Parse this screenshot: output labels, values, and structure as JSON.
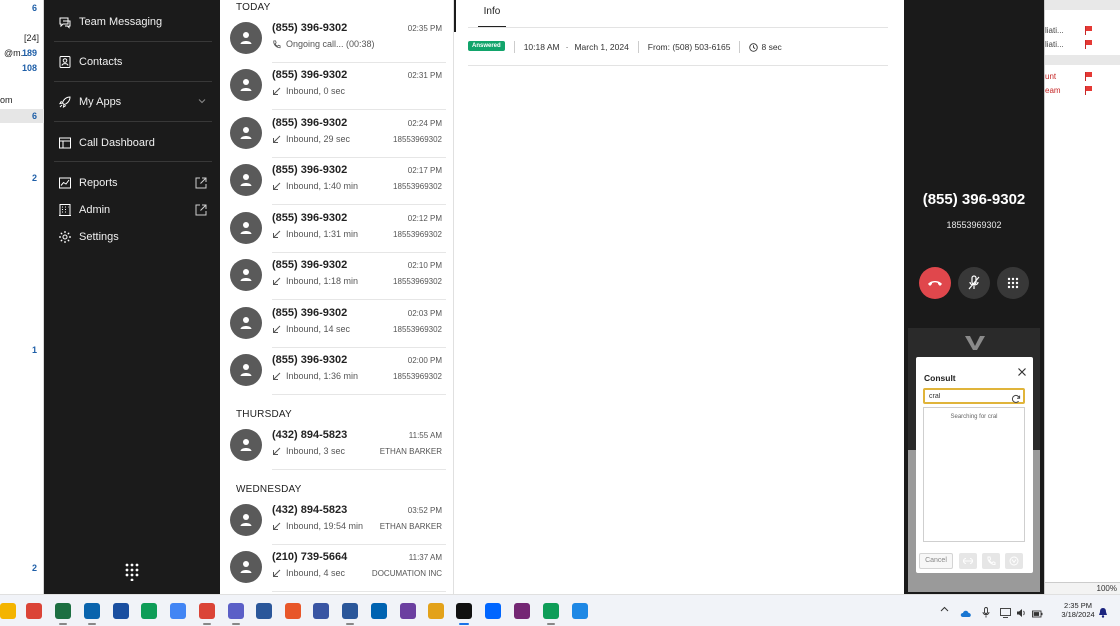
{
  "background_left": {
    "cells": [
      {
        "text": "6",
        "style": "blue"
      },
      {
        "text": "[24]",
        "style": "plain"
      },
      {
        "text": "@m...",
        "style": "plain"
      },
      {
        "text": "189",
        "style": "blue"
      },
      {
        "text": "108",
        "style": "blue"
      },
      {
        "text": "om",
        "style": "plain"
      },
      {
        "text": "6",
        "style": "blue"
      },
      {
        "text": "2",
        "style": "blue"
      },
      {
        "text": "1",
        "style": "blue"
      },
      {
        "text": "2",
        "style": "blue"
      }
    ]
  },
  "background_right": {
    "rows": [
      {
        "text": "liati...",
        "red": false
      },
      {
        "text": "liati...",
        "red": false
      },
      {
        "text": "unt",
        "red": true
      },
      {
        "text": "eam",
        "red": true
      }
    ],
    "zoom": "100%"
  },
  "sidebar": {
    "items": [
      {
        "label": "Team Messaging",
        "icon": "chat-bubbles-icon"
      },
      {
        "label": "Contacts",
        "icon": "contact-card-icon"
      },
      {
        "label": "My Apps",
        "icon": "rocket-icon"
      },
      {
        "label": "Call Dashboard",
        "icon": "dashboard-icon"
      },
      {
        "label": "Reports",
        "icon": "chart-icon"
      },
      {
        "label": "Admin",
        "icon": "building-icon"
      },
      {
        "label": "Settings",
        "icon": "gear-icon"
      }
    ]
  },
  "call_list": {
    "sections": [
      {
        "heading": "TODAY"
      },
      {
        "heading": "THURSDAY"
      },
      {
        "heading": "WEDNESDAY"
      }
    ],
    "calls": [
      {
        "number": "(855) 396-9302",
        "time": "02:35 PM",
        "detail": "Ongoing call... (00:38)",
        "ident": "",
        "kind": "ongoing"
      },
      {
        "number": "(855) 396-9302",
        "time": "02:31 PM",
        "detail": "Inbound, 0 sec",
        "ident": "",
        "kind": "inbound"
      },
      {
        "number": "(855) 396-9302",
        "time": "02:24 PM",
        "detail": "Inbound, 29 sec",
        "ident": "18553969302",
        "kind": "inbound"
      },
      {
        "number": "(855) 396-9302",
        "time": "02:17 PM",
        "detail": "Inbound, 1:40 min",
        "ident": "18553969302",
        "kind": "inbound"
      },
      {
        "number": "(855) 396-9302",
        "time": "02:12 PM",
        "detail": "Inbound, 1:31 min",
        "ident": "18553969302",
        "kind": "inbound"
      },
      {
        "number": "(855) 396-9302",
        "time": "02:10 PM",
        "detail": "Inbound, 1:18 min",
        "ident": "18553969302",
        "kind": "inbound"
      },
      {
        "number": "(855) 396-9302",
        "time": "02:03 PM",
        "detail": "Inbound, 14 sec",
        "ident": "18553969302",
        "kind": "inbound"
      },
      {
        "number": "(855) 396-9302",
        "time": "02:00 PM",
        "detail": "Inbound, 1:36 min",
        "ident": "18553969302",
        "kind": "inbound"
      },
      {
        "number": "(432) 894-5823",
        "time": "11:55 AM",
        "detail": "Inbound, 3 sec",
        "ident": "ETHAN BARKER",
        "kind": "inbound"
      },
      {
        "number": "(432) 894-5823",
        "time": "03:52 PM",
        "detail": "Inbound, 19:54 min",
        "ident": "ETHAN BARKER",
        "kind": "inbound"
      },
      {
        "number": "(210) 739-5664",
        "time": "11:37 AM",
        "detail": "Inbound, 4 sec",
        "ident": "DOCUMATION INC",
        "kind": "inbound"
      }
    ]
  },
  "detail": {
    "tab_label": "Info",
    "status_badge": "Answered",
    "time": "10:18 AM",
    "separator": "·",
    "date": "March 1, 2024",
    "from": "From: (508) 503-6165",
    "duration": "8 sec"
  },
  "call_panel": {
    "number": "(855) 396-9302",
    "sub_number": "18553969302"
  },
  "consult": {
    "title": "Consult",
    "search_value": "cral",
    "status": "Searching for cral",
    "cancel_label": "Cancel"
  },
  "taskbar": {
    "apps": [
      {
        "name": "file-explorer-icon",
        "color": "#f4b400"
      },
      {
        "name": "chrome-icon",
        "color": "#db4437"
      },
      {
        "name": "excel-icon",
        "color": "#1d6f42"
      },
      {
        "name": "outlook-icon",
        "color": "#0a64ad"
      },
      {
        "name": "onepassword-icon",
        "color": "#1a4fa0"
      },
      {
        "name": "edge-icon",
        "color": "#0f9d58"
      },
      {
        "name": "chrome-icon",
        "color": "#4285f4"
      },
      {
        "name": "chrome-profile-icon",
        "color": "#db4437"
      },
      {
        "name": "teams-icon",
        "color": "#5b5fc7"
      },
      {
        "name": "remote-desktop-icon",
        "color": "#2b579a"
      },
      {
        "name": "app-orange-icon",
        "color": "#e8572a"
      },
      {
        "name": "visio-icon",
        "color": "#3955a3"
      },
      {
        "name": "word-icon",
        "color": "#2b579a"
      },
      {
        "name": "font-app-icon",
        "color": "#0063b1"
      },
      {
        "name": "people-app-icon",
        "color": "#6b3fa0"
      },
      {
        "name": "snipping-icon",
        "color": "#e3a21a"
      },
      {
        "name": "vonage-icon",
        "color": "#111111"
      },
      {
        "name": "power-automate-icon",
        "color": "#0066ff"
      },
      {
        "name": "app-purple-icon",
        "color": "#742774"
      },
      {
        "name": "chrome-icon",
        "color": "#0f9d58"
      },
      {
        "name": "app-window-icon",
        "color": "#1e88e5"
      }
    ],
    "clock_time": "2:35 PM",
    "clock_date": "3/18/2024"
  }
}
